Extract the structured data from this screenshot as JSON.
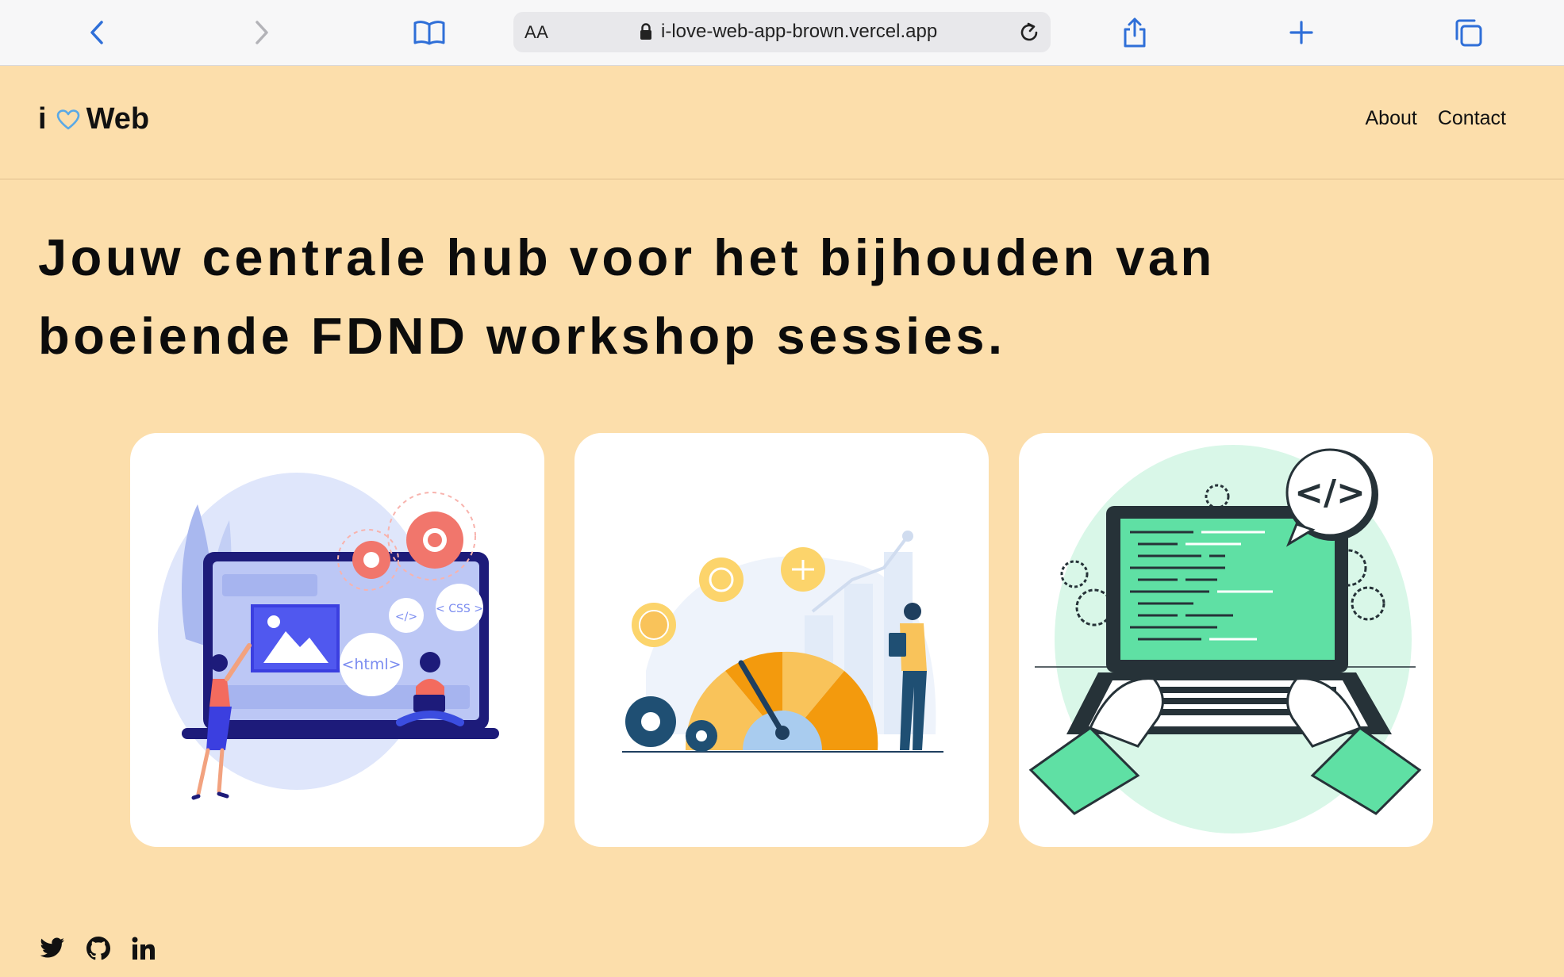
{
  "browser": {
    "reader_label": "AA",
    "url": "i-love-web-app-brown.vercel.app",
    "icons": [
      "back-icon",
      "forward-icon",
      "bookmarks-icon",
      "lock-icon",
      "reload-icon",
      "share-icon",
      "new-tab-icon",
      "tabs-icon"
    ]
  },
  "header": {
    "logo_prefix": "i",
    "logo_suffix": "Web",
    "nav": [
      {
        "label": "About"
      },
      {
        "label": "Contact"
      }
    ]
  },
  "hero": {
    "line1": "Jouw centrale hub voor het bijhouden van",
    "line2": "boeiende FDND workshop sessies."
  },
  "cards": [
    {
      "illustration": "web-design-illustration",
      "badges": [
        "</>",
        "< CSS >",
        "<html>"
      ]
    },
    {
      "illustration": "performance-gauge-illustration"
    },
    {
      "illustration": "coding-laptop-illustration",
      "badge": "</>"
    }
  ],
  "social": [
    "twitter-icon",
    "github-icon",
    "linkedin-icon"
  ],
  "colors": {
    "page_bg": "#fcdeab",
    "accent_blue": "#2f6fd8",
    "heart_blue": "#5aa9e6"
  }
}
